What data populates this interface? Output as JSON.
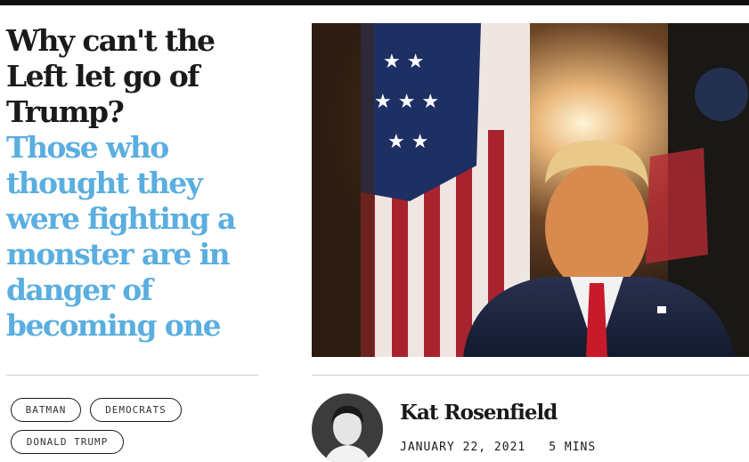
{
  "article": {
    "title": "Why can't the Left let go of Trump?",
    "dek": "Those who thought they were fighting a monster are in danger of becoming one",
    "tags": [
      "BATMAN",
      "DEMOCRATS",
      "DONALD TRUMP"
    ],
    "author": "Kat Rosenfield",
    "date": "JANUARY 22, 2021",
    "read_time": "5 MINS"
  },
  "colors": {
    "accent": "#5aaee0",
    "text": "#1a1a1a",
    "topbar": "#111111"
  }
}
